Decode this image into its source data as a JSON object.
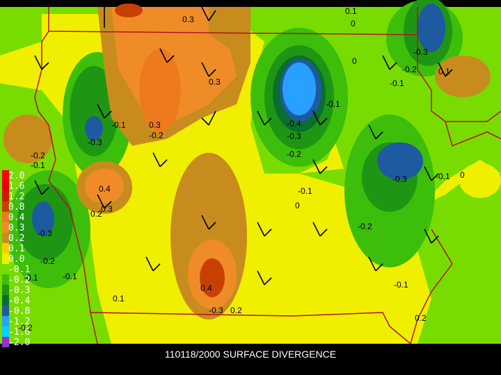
{
  "title": "110118/2000 SURFACE DIVERGENCE",
  "legend": {
    "entries": [
      {
        "label": "2.0",
        "color": "#ff0000"
      },
      {
        "label": "1.6",
        "color": "#e60000"
      },
      {
        "label": "1.2",
        "color": "#cc1a00"
      },
      {
        "label": "0.8",
        "color": "#c84000"
      },
      {
        "label": "0.4",
        "color": "#ee7a1e"
      },
      {
        "label": "0.3",
        "color": "#f08c28"
      },
      {
        "label": "0.2",
        "color": "#c88c1e"
      },
      {
        "label": "0.1",
        "color": "#f5d000"
      },
      {
        "label": "0.0",
        "color": "#f0ef00"
      },
      {
        "label": "-0.1",
        "color": "#78dc00"
      },
      {
        "label": "-0.2",
        "color": "#3cbe0a"
      },
      {
        "label": "-0.3",
        "color": "#1e9614"
      },
      {
        "label": "-0.4",
        "color": "#0a6e2e"
      },
      {
        "label": "-0.8",
        "color": "#1e5aa0"
      },
      {
        "label": "-1.2",
        "color": "#28a0ff"
      },
      {
        "label": "-1.6",
        "color": "#00d2ff"
      },
      {
        "label": "-2.0",
        "color": "#9632c8"
      }
    ]
  },
  "contour_labels": [
    {
      "text": "0.3"
    },
    {
      "text": "0.1"
    },
    {
      "text": "0"
    },
    {
      "text": "0.3"
    },
    {
      "text": "0.3"
    },
    {
      "text": "-0.2"
    },
    {
      "text": "-0.1"
    },
    {
      "text": "-0.3"
    },
    {
      "text": "-0.2"
    },
    {
      "text": "-0.1"
    },
    {
      "text": "0.1"
    },
    {
      "text": "-0.1"
    },
    {
      "text": "-0.2"
    },
    {
      "text": "-0.4"
    },
    {
      "text": "-0.3"
    },
    {
      "text": "-0.2"
    },
    {
      "text": "-0.1"
    },
    {
      "text": "0"
    },
    {
      "text": "-0.3"
    },
    {
      "text": "-0.1"
    },
    {
      "text": "0"
    },
    {
      "text": "-0.2"
    },
    {
      "text": "-0.1"
    },
    {
      "text": "0"
    },
    {
      "text": "0.4"
    },
    {
      "text": "0.3"
    },
    {
      "text": "0.2"
    },
    {
      "text": "-0.3"
    },
    {
      "text": "-0.2"
    },
    {
      "text": "-0.1"
    },
    {
      "text": "0.1"
    },
    {
      "text": "0.4"
    },
    {
      "text": "-0.3"
    },
    {
      "text": "0.2"
    },
    {
      "text": "-0.3"
    },
    {
      "text": "-0.1"
    },
    {
      "text": "-0.2"
    },
    {
      "text": "0.2"
    },
    {
      "text": "-0.1"
    }
  ]
}
